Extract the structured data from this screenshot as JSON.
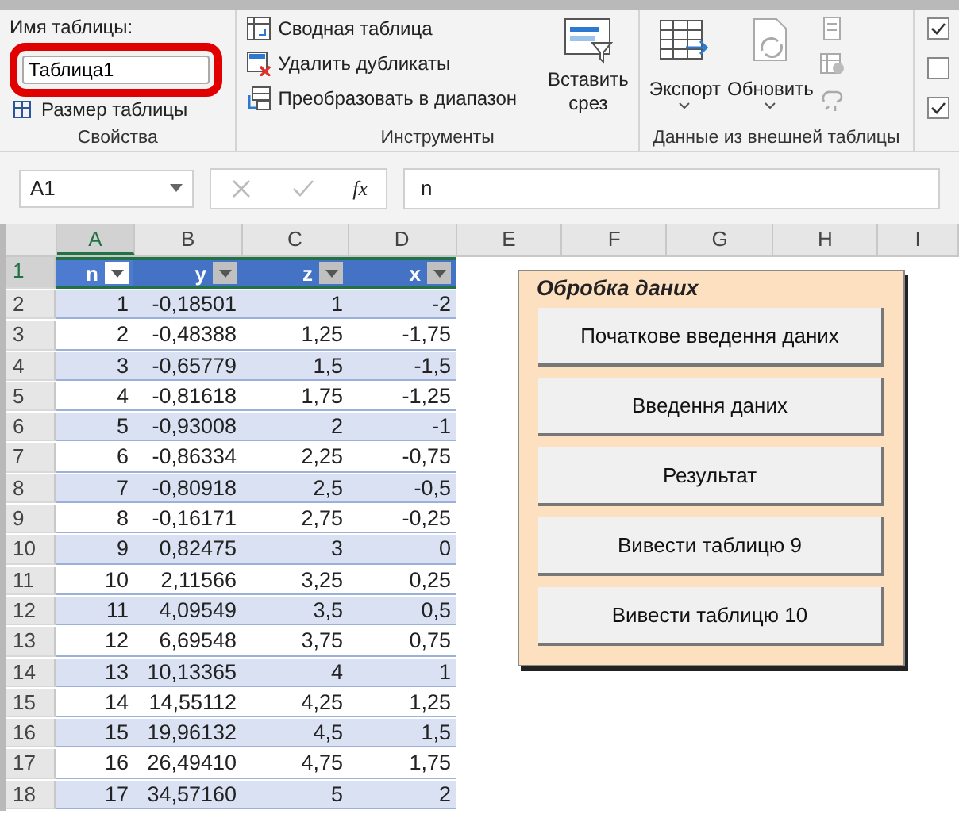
{
  "ribbon": {
    "groups": [
      {
        "kind": "properties",
        "label": "Свойства",
        "name_label": "Имя таблицы:",
        "name_value": "Таблица1",
        "resize": "Размер таблицы"
      },
      {
        "kind": "tools",
        "label": "Инструменты",
        "items": [
          "Сводная таблица",
          "Удалить дубликаты",
          "Преобразовать в диапазон"
        ],
        "slicer": [
          "Вставить",
          "срез"
        ]
      },
      {
        "kind": "external",
        "label": "Данные из внешней таблицы",
        "export": "Экспорт",
        "refresh": "Обновить"
      },
      {
        "kind": "options",
        "checks": [
          {
            "checked": true
          },
          {
            "checked": false
          },
          {
            "checked": true
          }
        ]
      }
    ]
  },
  "formula_bar": {
    "name_box": "A1",
    "function_label": "fx",
    "value": "n"
  },
  "sheet": {
    "columns": [
      {
        "label": "A",
        "selected": true
      },
      {
        "label": "B",
        "selected": false
      },
      {
        "label": "C",
        "selected": false
      },
      {
        "label": "D",
        "selected": false
      },
      {
        "label": "E",
        "selected": false
      },
      {
        "label": "F",
        "selected": false
      },
      {
        "label": "G",
        "selected": false
      },
      {
        "label": "H",
        "selected": false
      },
      {
        "label": "I",
        "selected": false
      }
    ],
    "table_header": [
      "n",
      "y",
      "z",
      "x"
    ],
    "rows": [
      [
        "1",
        "-0,18501",
        "1",
        "-2"
      ],
      [
        "2",
        "-0,48388",
        "1,25",
        "-1,75"
      ],
      [
        "3",
        "-0,65779",
        "1,5",
        "-1,5"
      ],
      [
        "4",
        "-0,81618",
        "1,75",
        "-1,25"
      ],
      [
        "5",
        "-0,93008",
        "2",
        "-1"
      ],
      [
        "6",
        "-0,86334",
        "2,25",
        "-0,75"
      ],
      [
        "7",
        "-0,80918",
        "2,5",
        "-0,5"
      ],
      [
        "8",
        "-0,16171",
        "2,75",
        "-0,25"
      ],
      [
        "9",
        "0,82475",
        "3",
        "0"
      ],
      [
        "10",
        "2,11566",
        "3,25",
        "0,25"
      ],
      [
        "11",
        "4,09549",
        "3,5",
        "0,5"
      ],
      [
        "12",
        "6,69548",
        "3,75",
        "0,75"
      ],
      [
        "13",
        "10,13365",
        "4",
        "1"
      ],
      [
        "14",
        "14,55112",
        "4,25",
        "1,25"
      ],
      [
        "15",
        "19,96132",
        "4,5",
        "1,5"
      ],
      [
        "16",
        "26,49410",
        "4,75",
        "1,75"
      ],
      [
        "17",
        "34,57160",
        "5",
        "2"
      ]
    ],
    "row_numbers": [
      "1",
      "2",
      "3",
      "4",
      "5",
      "6",
      "7",
      "8",
      "9",
      "10",
      "11",
      "12",
      "13",
      "14",
      "15",
      "16",
      "17",
      "18"
    ]
  },
  "panel": {
    "title": "Обробка даних",
    "buttons": [
      "Початкове введення даних",
      "Введення даних",
      "Результат",
      "Вивести таблицю 9",
      "Вивести таблицю 10"
    ]
  }
}
